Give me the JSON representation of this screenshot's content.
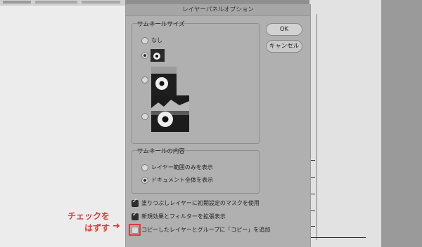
{
  "dialog": {
    "title": "レイヤーパネルオプション",
    "ok_label": "OK",
    "cancel_label": "キャンセル"
  },
  "thumbnail_size": {
    "label": "サムネールサイズ",
    "options": [
      {
        "label": "なし",
        "selected": false
      },
      {
        "label": "",
        "selected": true,
        "size": "small"
      },
      {
        "label": "",
        "selected": false,
        "size": "medium"
      },
      {
        "label": "",
        "selected": false,
        "size": "large"
      }
    ]
  },
  "thumbnail_contents": {
    "label": "サムネールの内容",
    "options": [
      {
        "label": "レイヤー範囲のみを表示",
        "selected": false
      },
      {
        "label": "ドキュメント全体を表示",
        "selected": true
      }
    ]
  },
  "checkboxes": [
    {
      "label": "塗りつぶしレイヤーに初期設定のマスクを使用",
      "checked": true
    },
    {
      "label": "新規効果とフィルターを拡張表示",
      "checked": true
    },
    {
      "label": "コピーしたレイヤーとグループに「コピー」を追加",
      "checked": false
    }
  ],
  "annotation": {
    "line1": "チェックを",
    "line2": "はずす",
    "color": "#e23b3b"
  },
  "colors": {
    "dialog_bg": "#b0b0b0",
    "highlight": "#e0393b"
  }
}
